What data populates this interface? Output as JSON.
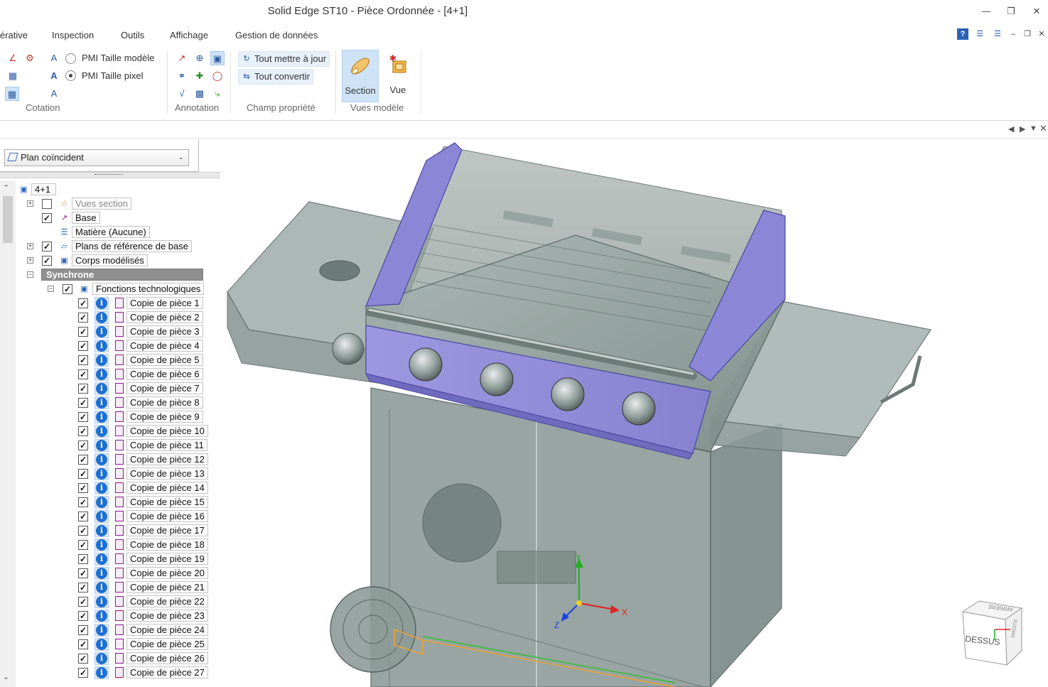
{
  "window": {
    "title": "Solid Edge ST10 - Pièce Ordonnée - [4+1]"
  },
  "menu": {
    "tabs": [
      "érative",
      "Inspection",
      "Outils",
      "Affichage",
      "Gestion de données"
    ]
  },
  "ribbon": {
    "groups": {
      "cotation": "Cotation",
      "annotation": "Annotation",
      "champ_propriete": "Champ propriété",
      "vues_modele": "Vues modèle"
    },
    "pmi_model_size": "PMI Taille modèle",
    "pmi_pixel_size": "PMI Taille pixel",
    "update_all": "Tout mettre à jour",
    "convert_all": "Tout convertir",
    "section_label": "Section",
    "view_label": "Vue"
  },
  "pathfinder": {
    "plan_select": "Plan coïncident",
    "tree": {
      "root": "4+1",
      "vues_section": "Vues section",
      "base": "Base",
      "matiere": "Matière (Aucune)",
      "plans_reference": "Plans de référence de base",
      "corps_modelises": "Corps modélisés",
      "synchrone": "Synchrone",
      "fonctions_technologiques": "Fonctions technologiques",
      "copies": [
        "Copie de pièce 1",
        "Copie de pièce 2",
        "Copie de pièce 3",
        "Copie de pièce 4",
        "Copie de pièce 5",
        "Copie de pièce 6",
        "Copie de pièce 7",
        "Copie de pièce 8",
        "Copie de pièce 9",
        "Copie de pièce 10",
        "Copie de pièce 11",
        "Copie de pièce 12",
        "Copie de pièce 13",
        "Copie de pièce 14",
        "Copie de pièce 15",
        "Copie de pièce 16",
        "Copie de pièce 17",
        "Copie de pièce 18",
        "Copie de pièce 19",
        "Copie de pièce 20",
        "Copie de pièce 21",
        "Copie de pièce 22",
        "Copie de pièce 23",
        "Copie de pièce 24",
        "Copie de pièce 25",
        "Copie de pièce 26",
        "Copie de pièce 27"
      ]
    },
    "checked": {
      "vues_section": false,
      "base": true,
      "plans_reference": true,
      "corps_modelises": true,
      "fonctions_technologiques": true,
      "copies": true
    }
  },
  "viewport": {
    "axes": {
      "x": "X",
      "y": "Y",
      "z": "Z"
    },
    "view_cube": {
      "top": "DESSUS",
      "back": "ARRIÈRE",
      "right": "DROITE"
    },
    "colors": {
      "body": "#8a9a96",
      "lid": "#8c88d8",
      "axis_x": "#e02020",
      "axis_y": "#20b020",
      "axis_z": "#2040e0",
      "highlight": "#f0a030"
    }
  }
}
